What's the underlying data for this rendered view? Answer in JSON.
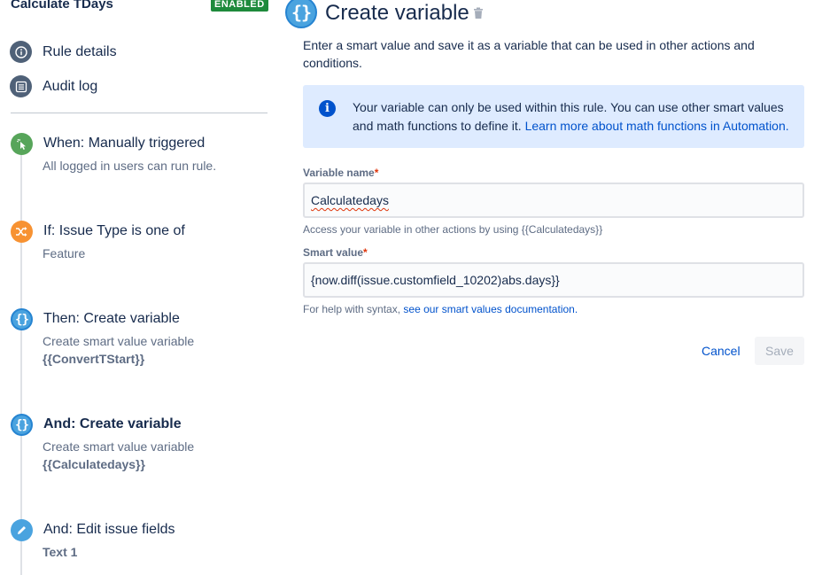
{
  "rule": {
    "title": "Calculate TDays",
    "status_badge": "ENABLED"
  },
  "nav": [
    {
      "label": "Rule details",
      "icon": "info-icon"
    },
    {
      "label": "Audit log",
      "icon": "list-icon"
    }
  ],
  "steps": [
    {
      "title": "When: Manually triggered",
      "desc": "All logged in users can run rule.",
      "icon": "pointer-click-icon",
      "color": "#57a55a"
    },
    {
      "title": "If: Issue Type is one of",
      "desc": "Feature",
      "icon": "shuffle-icon",
      "color": "#f79232"
    },
    {
      "title": "Then: Create variable",
      "desc": "Create smart value variable",
      "desc2": "{{ConvertTStart}}",
      "icon": "braces-icon",
      "color": "#4aa3df"
    },
    {
      "title": "And: Create variable",
      "desc": "Create smart value variable",
      "desc2": "{{Calculatedays}}",
      "icon": "braces-icon",
      "color": "#4aa3df"
    },
    {
      "title": "And: Edit issue fields",
      "desc": "Text 1",
      "icon": "pencil-icon",
      "color": "#4aa3df"
    }
  ],
  "editor": {
    "icon_text": "{}",
    "title": "Create variable",
    "intro": "Enter a smart value and save it as a variable that can be used in other actions and conditions.",
    "info_text": "Your variable can only be used within this rule. You can use other smart values and math functions to define it.",
    "info_link": "Learn more about math functions in Automation.",
    "variable_name_label": "Variable name",
    "variable_name_value": "Calculatedays",
    "variable_name_help": "Access your variable in other actions by using {{Calculatedays}}",
    "smart_value_label": "Smart value",
    "smart_value_value": "{now.diff(issue.customfield_10202)abs.days}}",
    "smart_value_help": "For help with syntax,",
    "smart_value_help_link": "see our smart values documentation.",
    "required_marker": "*",
    "cancel_label": "Cancel",
    "save_label": "Save"
  },
  "colors": {
    "accent": "#0052cc",
    "enabled_badge": "#1e8a3c",
    "info_bg": "#deebff"
  }
}
